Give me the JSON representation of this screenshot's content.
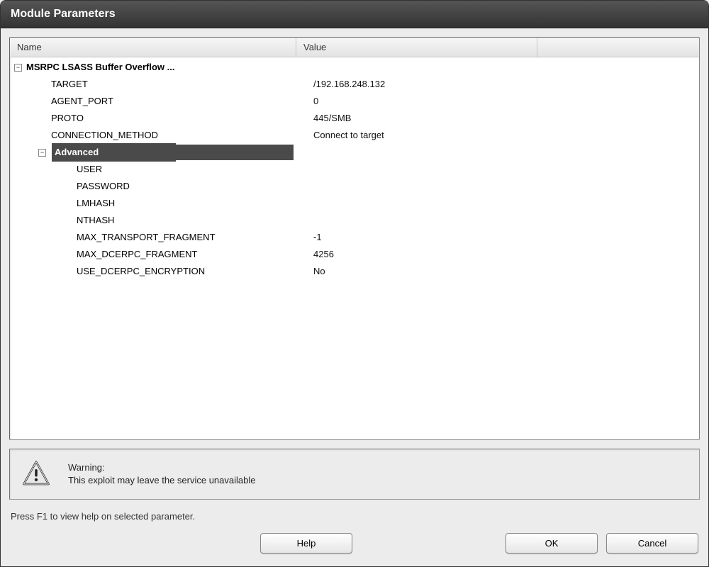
{
  "window": {
    "title": "Module Parameters"
  },
  "columns": {
    "name": "Name",
    "value": "Value"
  },
  "tree": {
    "root_label": "MSRPC LSASS Buffer Overflow ...",
    "params": [
      {
        "name": "TARGET",
        "value": "/192.168.248.132"
      },
      {
        "name": "AGENT_PORT",
        "value": "0"
      },
      {
        "name": "PROTO",
        "value": "445/SMB"
      },
      {
        "name": "CONNECTION_METHOD",
        "value": "Connect to target"
      }
    ],
    "advanced_label": "Advanced",
    "advanced_params": [
      {
        "name": "USER",
        "value": ""
      },
      {
        "name": "PASSWORD",
        "value": ""
      },
      {
        "name": "LMHASH",
        "value": ""
      },
      {
        "name": "NTHASH",
        "value": ""
      },
      {
        "name": "MAX_TRANSPORT_FRAGMENT",
        "value": "-1"
      },
      {
        "name": "MAX_DCERPC_FRAGMENT",
        "value": "4256"
      },
      {
        "name": "USE_DCERPC_ENCRYPTION",
        "value": "No"
      }
    ]
  },
  "warning": {
    "title": "Warning:",
    "message": "This exploit may leave the service unavailable"
  },
  "hint": "Press F1 to view help on selected parameter.",
  "buttons": {
    "help": "Help",
    "ok": "OK",
    "cancel": "Cancel"
  }
}
